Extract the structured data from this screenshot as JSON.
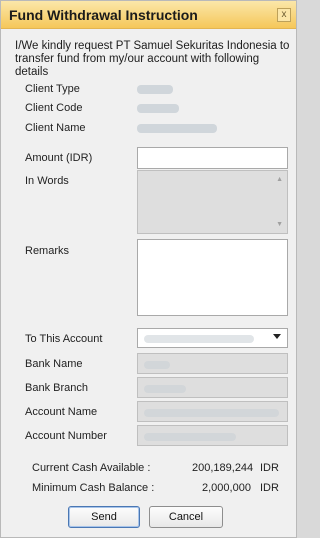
{
  "window": {
    "title": "Fund Withdrawal Instruction",
    "close_label": "x"
  },
  "intro": "I/We kindly request PT Samuel Sekuritas Indonesia to transfer fund from my/our account with following details",
  "client": {
    "type_label": "Client Type",
    "code_label": "Client Code",
    "name_label": "Client Name"
  },
  "form": {
    "amount_label": "Amount (IDR)",
    "amount_value": "",
    "in_words_label": "In Words",
    "remarks_label": "Remarks",
    "remarks_value": ""
  },
  "bank": {
    "to_account_label": "To This Account",
    "bank_name_label": "Bank Name",
    "bank_branch_label": "Bank Branch",
    "account_name_label": "Account Name",
    "account_number_label": "Account Number"
  },
  "summary": {
    "current_label": "Current Cash Available :",
    "current_value": "200,189,244",
    "current_currency": "IDR",
    "minimum_label": "Minimum Cash Balance :",
    "minimum_value": "2,000,000",
    "minimum_currency": "IDR"
  },
  "buttons": {
    "send": "Send",
    "cancel": "Cancel"
  }
}
